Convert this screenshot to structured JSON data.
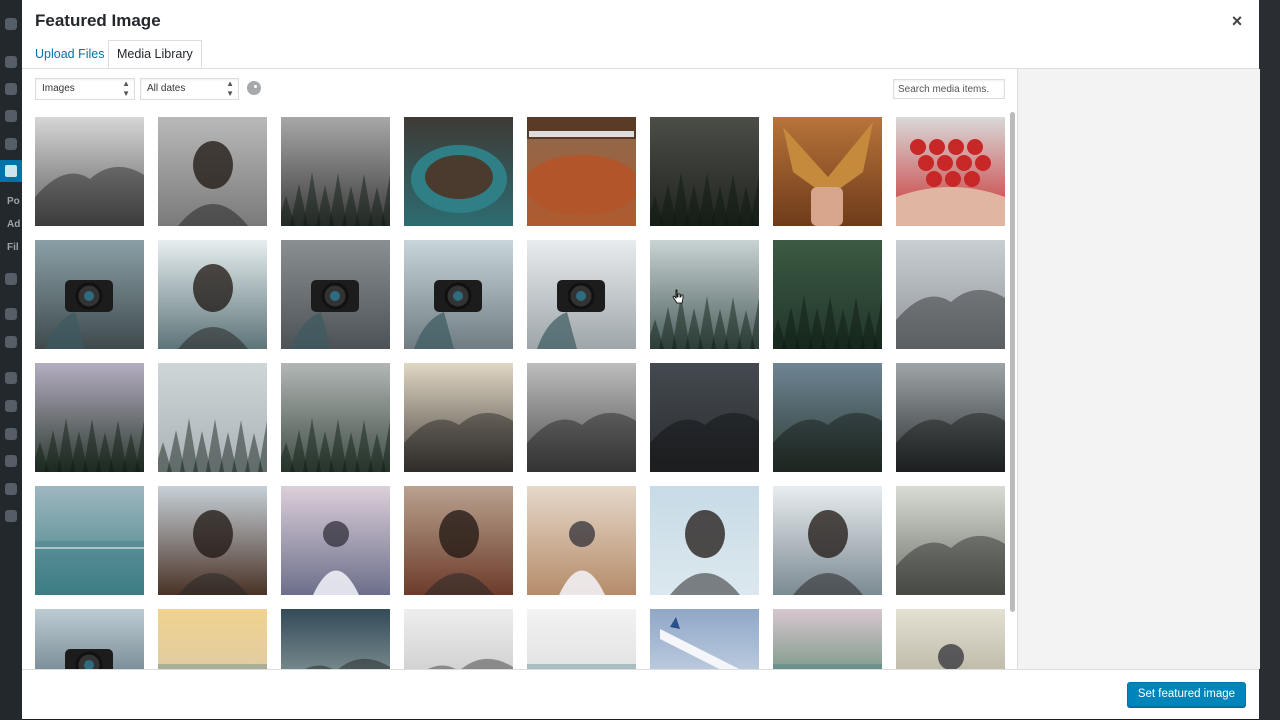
{
  "modal": {
    "title": "Featured Image",
    "close_label": "×"
  },
  "tabs": [
    {
      "label": "Upload Files"
    },
    {
      "label": "Media Library"
    }
  ],
  "filters": {
    "type_value": "Images",
    "date_value": "All dates",
    "search_placeholder": "Search media items..."
  },
  "footer": {
    "button_label": "Set featured image"
  },
  "colors": {
    "accent": "#0085ba",
    "link": "#0073aa"
  },
  "admin_sidebar": {
    "partial_labels": [
      "Po",
      "Ad",
      "Fil"
    ]
  },
  "media_items": [
    {
      "name": "foggy-coastline",
      "top": "#d6d6d6",
      "bottom": "#5d5d5d",
      "shape": "hill"
    },
    {
      "name": "woman-hair-fog",
      "top": "#b9b9b9",
      "bottom": "#7a7a7a",
      "shape": "figure-dark"
    },
    {
      "name": "foggy-treeline",
      "top": "#a8a8a8",
      "bottom": "#3a3a3a",
      "shape": "trees"
    },
    {
      "name": "teal-bowl-food",
      "top": "#3e3a35",
      "bottom": "#2d6c72",
      "shape": "bowl"
    },
    {
      "name": "bread-loaf-knife",
      "top": "#8b6a4f",
      "bottom": "#b05a2f",
      "shape": "loaf"
    },
    {
      "name": "dark-forest",
      "top": "#4b4e47",
      "bottom": "#20231f",
      "shape": "trees"
    },
    {
      "name": "autumn-leaves-hands",
      "top": "#b8743a",
      "bottom": "#6e3b1a",
      "shape": "leaves"
    },
    {
      "name": "strawberries-hands",
      "top": "#d9d9d9",
      "bottom": "#c93030",
      "shape": "berries"
    },
    {
      "name": "camera-road-trees",
      "top": "#8aa0a6",
      "bottom": "#3f4a4d",
      "shape": "camera"
    },
    {
      "name": "woman-sparkler",
      "top": "#e7eef0",
      "bottom": "#5d7478",
      "shape": "figure-dark"
    },
    {
      "name": "camera-knit-sweater",
      "top": "#8a8f92",
      "bottom": "#4c5256",
      "shape": "camera"
    },
    {
      "name": "hooded-photographer",
      "top": "#c8d6dc",
      "bottom": "#6f7d83",
      "shape": "camera"
    },
    {
      "name": "nikon-camera-hand",
      "top": "#e9ecee",
      "bottom": "#9ea6aa",
      "shape": "camera"
    },
    {
      "name": "misty-pine-tree",
      "top": "#c9d3d3",
      "bottom": "#4b5f5c",
      "shape": "trees"
    },
    {
      "name": "green-forest-aerial",
      "top": "#3b5a43",
      "bottom": "#22362a",
      "shape": "trees"
    },
    {
      "name": "snowy-mountain-valley",
      "top": "#c9cfd3",
      "bottom": "#8d9398",
      "shape": "hill"
    },
    {
      "name": "lavender-sky-forest",
      "top": "#b5aec2",
      "bottom": "#2c3a2f",
      "shape": "trees"
    },
    {
      "name": "snow-covered-trees",
      "top": "#cfd6d8",
      "bottom": "#a9b2b6",
      "shape": "trees"
    },
    {
      "name": "foggy-mountain-forest",
      "top": "#b2b7b5",
      "bottom": "#3f4d45",
      "shape": "trees"
    },
    {
      "name": "mountain-haze-sunset",
      "top": "#e0d7c4",
      "bottom": "#4a4440",
      "shape": "hill"
    },
    {
      "name": "clouds-mountain-peak",
      "top": "#bdbdbd",
      "bottom": "#4f4f4f",
      "shape": "hill"
    },
    {
      "name": "dark-mountain-road",
      "top": "#444a50",
      "bottom": "#2a2d30",
      "shape": "hill"
    },
    {
      "name": "mountain-valley-view",
      "top": "#6f8595",
      "bottom": "#2c3b31",
      "shape": "hill"
    },
    {
      "name": "storm-clouds-ridge",
      "top": "#9ea5a8",
      "bottom": "#2b2f30",
      "shape": "hill"
    },
    {
      "name": "sea-swimmer",
      "top": "#9fb7bf",
      "bottom": "#3c7f85",
      "shape": "water"
    },
    {
      "name": "couple-sunlight-window",
      "top": "#c6d0d8",
      "bottom": "#4a3225",
      "shape": "figure-dark"
    },
    {
      "name": "girl-cap-pink-sky",
      "top": "#dccfd9",
      "bottom": "#6c6f8b",
      "shape": "figure-light"
    },
    {
      "name": "woman-field-grass",
      "top": "#b9a28e",
      "bottom": "#6c3b2b",
      "shape": "figure-dark"
    },
    {
      "name": "woman-sand-sea",
      "top": "#e6d8c9",
      "bottom": "#b58c6a",
      "shape": "figure-light"
    },
    {
      "name": "snowboarder-snow",
      "top": "#c7dbe6",
      "bottom": "#dce8ef",
      "shape": "figure-dark"
    },
    {
      "name": "sparkler-portrait",
      "top": "#e8edf0",
      "bottom": "#7c8a92",
      "shape": "figure-dark"
    },
    {
      "name": "misty-hills-pale",
      "top": "#d9dcd4",
      "bottom": "#6d7068",
      "shape": "hill"
    },
    {
      "name": "camera-lake-reflection",
      "top": "#bccbd3",
      "bottom": "#4a5f6c",
      "shape": "camera"
    },
    {
      "name": "sunset-beach-people",
      "top": "#f1d38e",
      "bottom": "#d3c5b2",
      "shape": "water"
    },
    {
      "name": "teal-gradient-sky",
      "top": "#334a59",
      "bottom": "#a8b7b1",
      "shape": "hill"
    },
    {
      "name": "birds-snowy-peak",
      "top": "#eeeeee",
      "bottom": "#bcbcbc",
      "shape": "hill"
    },
    {
      "name": "cable-car-lines",
      "top": "#f3f3f3",
      "bottom": "#d5d5d5",
      "shape": "water"
    },
    {
      "name": "airplane-wing-sky",
      "top": "#8fa7c7",
      "bottom": "#dbe4ef",
      "shape": "wing"
    },
    {
      "name": "canoe-green-lake",
      "top": "#d7c7cf",
      "bottom": "#3f7a5a",
      "shape": "water"
    },
    {
      "name": "woman-hazy-field",
      "top": "#e4e1d4",
      "bottom": "#a49f8b",
      "shape": "figure-light"
    }
  ]
}
